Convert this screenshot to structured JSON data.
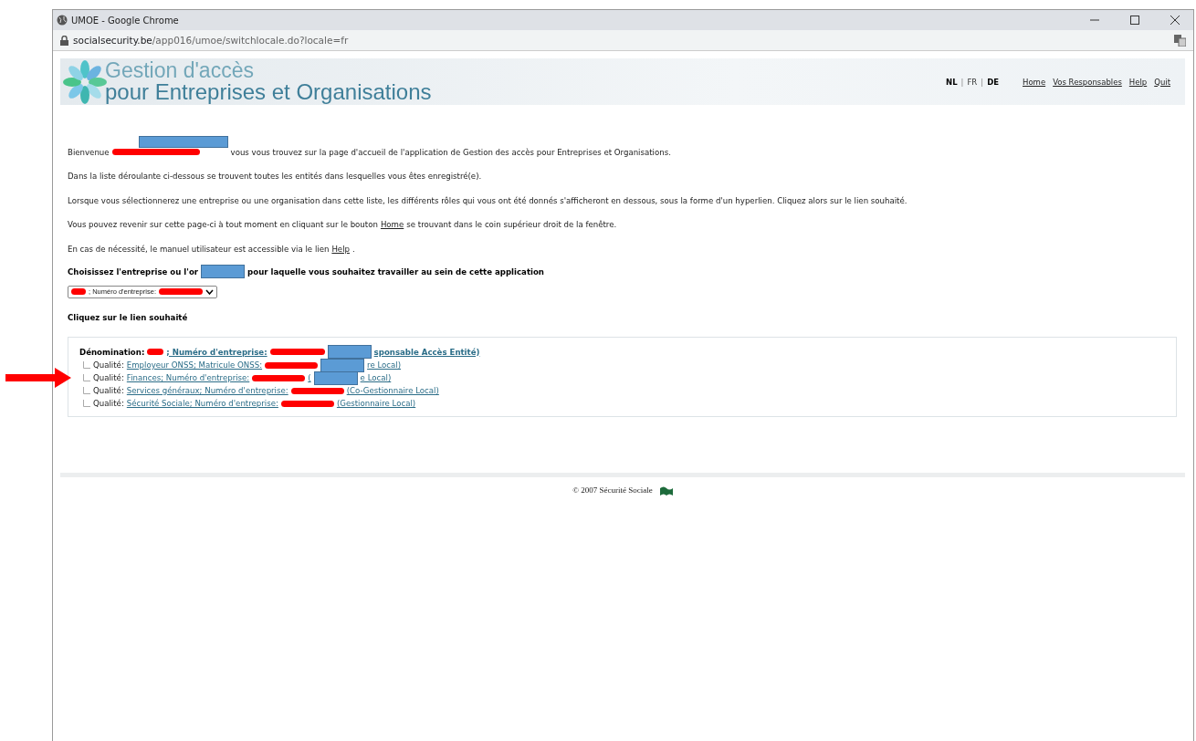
{
  "window": {
    "title": "UMOE - Google Chrome",
    "url_host": "socialsecurity.be",
    "url_path": "/app016/umoe/switchlocale.do?locale=fr"
  },
  "header": {
    "title_line1": "Gestion d'accès",
    "title_line2": "pour Entreprises et Organisations",
    "language_separator": "|",
    "languages": [
      {
        "label": "NL",
        "selected": false
      },
      {
        "label": "FR",
        "selected": true
      },
      {
        "label": "DE",
        "selected": false
      }
    ],
    "nav_links": [
      "Home",
      "Vos Responsables",
      "Help",
      "Quit"
    ]
  },
  "paragraphs": [
    [
      {
        "kind": "text",
        "text": "Bienvenue"
      },
      {
        "kind": "scribble"
      },
      {
        "kind": "box_raised"
      },
      {
        "kind": "text",
        "text": "vous vous trouvez sur la page d'accueil de l'application de Gestion des accès pour Entreprises et Organisations."
      }
    ],
    [
      {
        "kind": "text",
        "text": "Dans la liste déroulante ci-dessous se trouvent toutes les entités dans lesquelles vous êtes enregistré(e)."
      }
    ],
    [
      {
        "kind": "text",
        "text": "Lorsque vous sélectionnerez une entreprise ou une organisation dans cette liste, les différents rôles qui vous ont été donnés s'afficheront en dessous, sous la forme d'un hyperlien. Cliquez alors sur le lien souhaité."
      }
    ],
    [
      {
        "kind": "text",
        "text": "Vous pouvez revenir sur cette page-ci à tout moment en cliquant sur le bouton"
      },
      {
        "kind": "link",
        "text": "Home"
      },
      {
        "kind": "text",
        "text": "se trouvant dans le coin supérieur droit de la fenêtre."
      }
    ],
    [
      {
        "kind": "text",
        "text": "En cas de nécessité, le manuel utilisateur est accessible via le lien"
      },
      {
        "kind": "link",
        "text": "Help"
      },
      {
        "kind": "text",
        "text": "."
      }
    ]
  ],
  "choose_heading": [
    {
      "kind": "text",
      "text": "Choisissez l'entreprise ou l'or"
    },
    {
      "kind": "box"
    },
    {
      "kind": "text",
      "text": "pour laquelle vous souhaitez travailler au sein de cette application"
    }
  ],
  "entity_select": [
    {
      "kind": "scribble"
    },
    {
      "kind": "text",
      "text": "; Numéro d'entreprise:"
    },
    {
      "kind": "scribble"
    }
  ],
  "links_heading": "Cliquez sur le lien souhaité",
  "entity": {
    "label": "Dénomination:",
    "link": [
      {
        "kind": "scribble"
      },
      {
        "kind": "text",
        "text": "; Numéro d'entreprise:"
      },
      {
        "kind": "scribble"
      },
      {
        "kind": "box"
      },
      {
        "kind": "text",
        "text": "sponsable Accès Entité)"
      }
    ],
    "children": [
      {
        "label": "Qualité:",
        "link": [
          {
            "kind": "text",
            "text": "Employeur ONSS; Matricule ONSS:"
          },
          {
            "kind": "scribble"
          },
          {
            "kind": "box"
          },
          {
            "kind": "text",
            "text": "re Local)"
          }
        ]
      },
      {
        "label": "Qualité:",
        "link": [
          {
            "kind": "text",
            "text": "Finances; Numéro d'entreprise:"
          },
          {
            "kind": "scribble"
          },
          {
            "kind": "text",
            "text": "("
          },
          {
            "kind": "box"
          },
          {
            "kind": "text",
            "text": "e Local)"
          }
        ]
      },
      {
        "label": "Qualité:",
        "link": [
          {
            "kind": "text",
            "text": "Services généraux; Numéro d'entreprise:"
          },
          {
            "kind": "scribble"
          },
          {
            "kind": "text",
            "text": "(Co-Gestionnaire Local)"
          }
        ]
      },
      {
        "label": "Qualité:",
        "link": [
          {
            "kind": "text",
            "text": "Sécurité Sociale; Numéro d'entreprise:"
          },
          {
            "kind": "scribble"
          },
          {
            "kind": "text",
            "text": "(Gestionnaire Local)"
          }
        ]
      }
    ]
  },
  "footer": {
    "copyright": "© 2007 Sécurité Sociale"
  }
}
